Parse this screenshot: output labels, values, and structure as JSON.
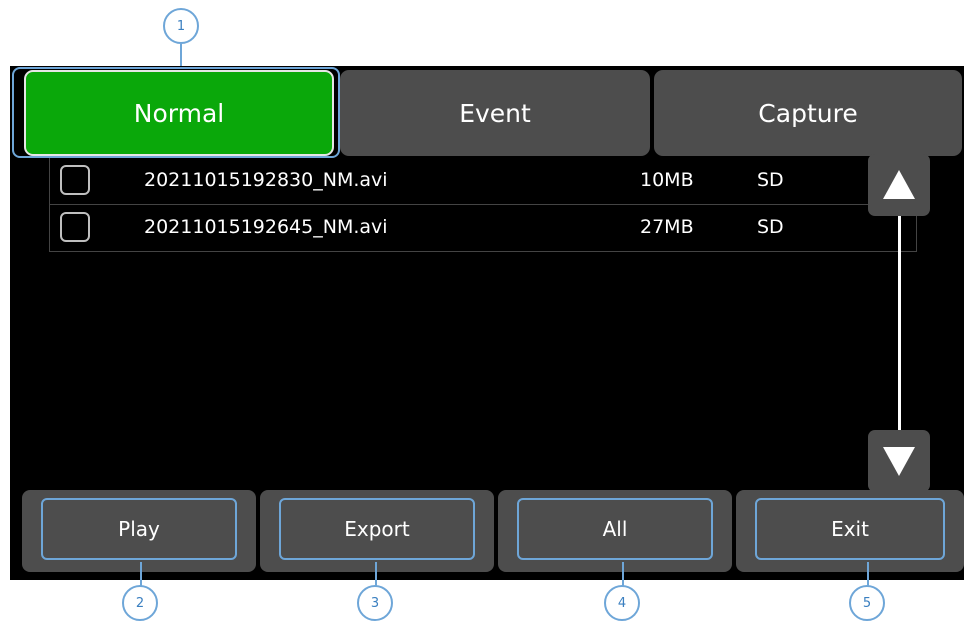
{
  "tabs": [
    {
      "label": "Normal",
      "active": true
    },
    {
      "label": "Event",
      "active": false
    },
    {
      "label": "Capture",
      "active": false
    }
  ],
  "files": [
    {
      "name": "20211015192830_NM.avi",
      "size": "10MB",
      "storage": "SD"
    },
    {
      "name": "20211015192645_NM.avi",
      "size": "27MB",
      "storage": "SD"
    }
  ],
  "buttons": {
    "play": "Play",
    "export": "Export",
    "all": "All",
    "exit": "Exit"
  },
  "markers": [
    "1",
    "2",
    "3",
    "4",
    "5"
  ],
  "colors": {
    "active_tab": "#0aa80a",
    "tab": "#4d4d4d",
    "callout": "#6ea6d8",
    "screen_bg": "#000000"
  },
  "icons": {
    "scroll_up": "triangle-up-icon",
    "scroll_down": "triangle-down-icon"
  }
}
